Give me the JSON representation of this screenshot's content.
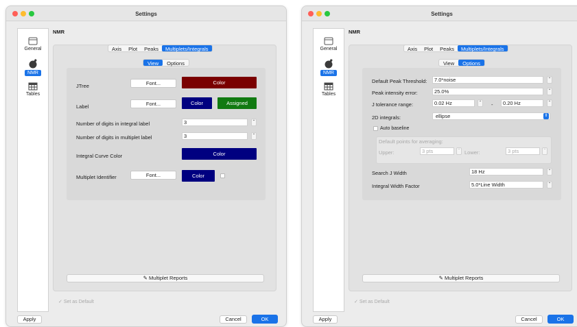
{
  "window_title": "Settings",
  "sidebar": {
    "items": [
      {
        "label": "General",
        "icon": "window-icon"
      },
      {
        "label": "NMR",
        "icon": "nmr-bulb-icon"
      },
      {
        "label": "Tables",
        "icon": "table-icon"
      }
    ]
  },
  "section_heading": "NMR",
  "tabs": [
    "Axis",
    "Plot",
    "Peaks",
    "Multiplets/Integrals"
  ],
  "subtabs": [
    "View",
    "Options"
  ],
  "view": {
    "jtree_label": "JTree",
    "jtree_font": "Font...",
    "jtree_color": "Color",
    "label_label": "Label",
    "label_font": "Font...",
    "label_color": "Color",
    "label_assigned": "Assigned",
    "digits_integral_label": "Number of digits in integral label",
    "digits_integral_value": "3",
    "digits_multiplet_label": "Number of digits in multiplet label",
    "digits_multiplet_value": "3",
    "integral_curve_label": "Integral Curve Color",
    "integral_curve_color": "Color",
    "multiplet_identifier_label": "Multiplet Identifier",
    "multiplet_identifier_font": "Font...",
    "multiplet_identifier_color": "Color"
  },
  "options": {
    "peak_threshold_label": "Default Peak Threshold:",
    "peak_threshold_value": "7.0*noise",
    "peak_intensity_label": "Peak intensity error:",
    "peak_intensity_value": "25.0%",
    "j_tolerance_label": "J tolerance range:",
    "j_tolerance_min": "0.02 Hz",
    "j_tolerance_sep": "-",
    "j_tolerance_max": "0.20 Hz",
    "integrals_2d_label": "2D integrals:",
    "integrals_2d_value": "ellipse",
    "auto_baseline_label": "Auto baseline",
    "default_points_label": "Default points for averaging:",
    "upper_label": "Upper:",
    "upper_value": "3 pts",
    "lower_label": "Lower:",
    "lower_value": "3 pts",
    "search_j_label": "Search J Width",
    "search_j_value": "18 Hz",
    "integral_width_label": "Integral Width Factor",
    "integral_width_value": "5.0*Line Width"
  },
  "multiplet_reports": "Multiplet Reports",
  "set_as_default": "Set as Default",
  "apply": "Apply",
  "cancel": "Cancel",
  "ok": "OK",
  "colors": {
    "accent": "#1a73e8",
    "jtree_color": "#7a0000",
    "label_color": "#000080",
    "assigned_color": "#117a11",
    "integral_curve_color": "#000080",
    "multiplet_identifier_color": "#000080"
  }
}
